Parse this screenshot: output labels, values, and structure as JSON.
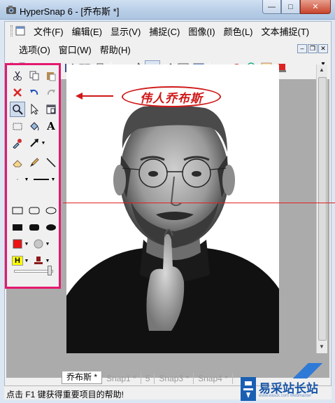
{
  "window": {
    "title": "HyperSnap 6 - [乔布斯 *]",
    "caption_min": "—",
    "caption_max": "□",
    "caption_close": "✕"
  },
  "menu": {
    "row1": [
      "文件(F)",
      "编辑(E)",
      "显示(V)",
      "捕捉(C)",
      "图像(I)",
      "颜色(L)",
      "文本捕捉(T)"
    ],
    "row2": [
      "选项(O)",
      "窗口(W)",
      "帮助(H)"
    ]
  },
  "toolbar": {
    "icons": [
      "new-icon",
      "open-icon",
      "open-folder-icon",
      "save-icon",
      "book-icon",
      "print-icon",
      "capture-icon",
      "tools-icon",
      "capture-active-icon",
      "pen-icon",
      "image-icon",
      "window-icon",
      "rotate-icon",
      "redo-icon",
      "refresh-icon",
      "edit-icon",
      "stamp-icon"
    ],
    "more": "▾"
  },
  "palette": {
    "tools": [
      "cut-icon",
      "copy-icon",
      "paste-icon",
      "delete-icon",
      "undo-icon",
      "redo-icon",
      "zoom-icon",
      "select-icon",
      "crop-icon",
      "rect-select-icon",
      "fill-icon",
      "text-icon",
      "eraser-icon",
      "pencil-icon",
      "line-icon",
      "rectangle-icon",
      "rounded-rect-icon",
      "ellipse-icon",
      "filled-rect-icon",
      "filled-rounded-rect-icon",
      "filled-ellipse-icon",
      "red-color-icon",
      "gray-color-icon",
      "highlight-icon",
      "stamp-icon"
    ],
    "highlight_label": "H",
    "text_label": "A",
    "fill_color": "#ff0000",
    "highlight_color": "#ffff00",
    "frame_color": "#e4196f"
  },
  "annotation": {
    "caption": "伟人乔布斯",
    "color": "#d01818"
  },
  "tabs": [
    {
      "label": "乔布斯 *",
      "active": true
    },
    {
      "label": "Snap1 *",
      "active": false
    },
    {
      "label": "5",
      "active": false
    },
    {
      "label": "Snap3 *",
      "active": false
    },
    {
      "label": "Snap4 *",
      "active": false
    }
  ],
  "status": {
    "text": "点击 F1 键获得重要项目的帮助!"
  },
  "watermark": {
    "site": "易采站长站",
    "sub": "www.easck.com  Webmaster"
  }
}
